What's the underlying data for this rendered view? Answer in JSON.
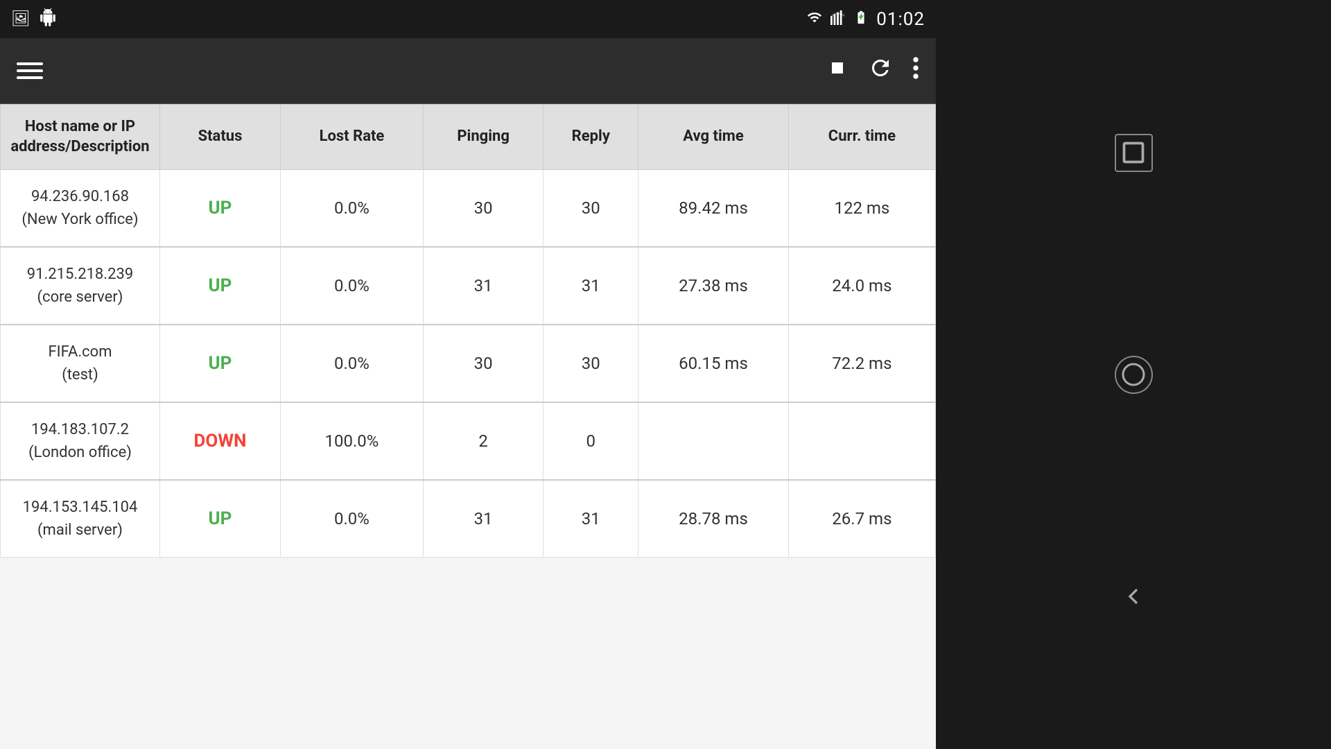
{
  "statusBar": {
    "time": "01:02",
    "icons": [
      "wifi",
      "signal",
      "battery"
    ]
  },
  "actionBar": {
    "stopLabel": "■",
    "refreshLabel": "↻",
    "moreLabel": "⋮"
  },
  "table": {
    "headers": [
      "Host name or IP address/Description",
      "Status",
      "Lost Rate",
      "Pinging",
      "Reply",
      "Avg time",
      "Curr. time"
    ],
    "rows": [
      {
        "host": "94.236.90.168\n(New York office)",
        "status": "UP",
        "statusType": "up",
        "lostRate": "0.0%",
        "pinging": "30",
        "reply": "30",
        "avgTime": "89.42 ms",
        "currTime": "122 ms"
      },
      {
        "host": "91.215.218.239\n(core server)",
        "status": "UP",
        "statusType": "up",
        "lostRate": "0.0%",
        "pinging": "31",
        "reply": "31",
        "avgTime": "27.38 ms",
        "currTime": "24.0 ms"
      },
      {
        "host": "FIFA.com\n(test)",
        "status": "UP",
        "statusType": "up",
        "lostRate": "0.0%",
        "pinging": "30",
        "reply": "30",
        "avgTime": "60.15 ms",
        "currTime": "72.2 ms"
      },
      {
        "host": "194.183.107.2\n(London office)",
        "status": "DOWN",
        "statusType": "down",
        "lostRate": "100.0%",
        "pinging": "2",
        "reply": "0",
        "avgTime": "",
        "currTime": ""
      },
      {
        "host": "194.153.145.104\n(mail server)",
        "status": "UP",
        "statusType": "up",
        "lostRate": "0.0%",
        "pinging": "31",
        "reply": "31",
        "avgTime": "28.78 ms",
        "currTime": "26.7 ms"
      }
    ]
  },
  "navButtons": {
    "squareLabel": "□",
    "circleLabel": "○",
    "backLabel": "◁"
  }
}
